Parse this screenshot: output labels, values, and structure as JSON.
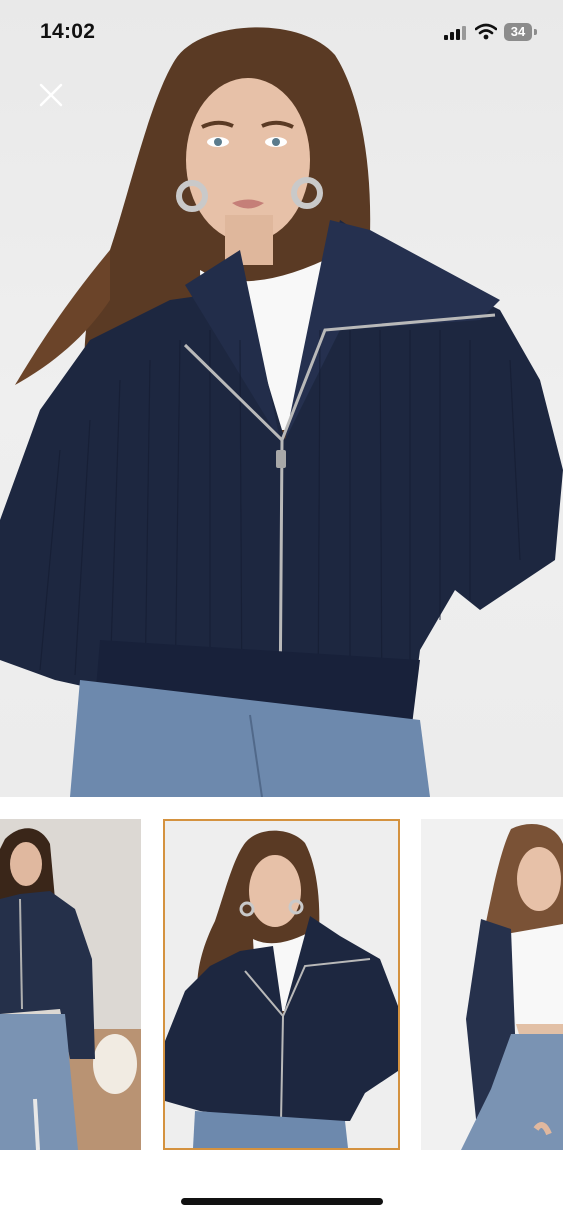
{
  "status_bar": {
    "time": "14:02",
    "battery": "34"
  },
  "hero": {
    "image_icon": "product-photo",
    "close_icon": "close-icon"
  },
  "thumbnails": [
    {
      "icon": "product-thumbnail",
      "selected": false
    },
    {
      "icon": "product-thumbnail",
      "selected": true
    },
    {
      "icon": "product-thumbnail",
      "selected": false
    }
  ],
  "colors": {
    "selected_border": "#d4923f",
    "sweater": "#1d2740",
    "background": "#ffffff"
  }
}
